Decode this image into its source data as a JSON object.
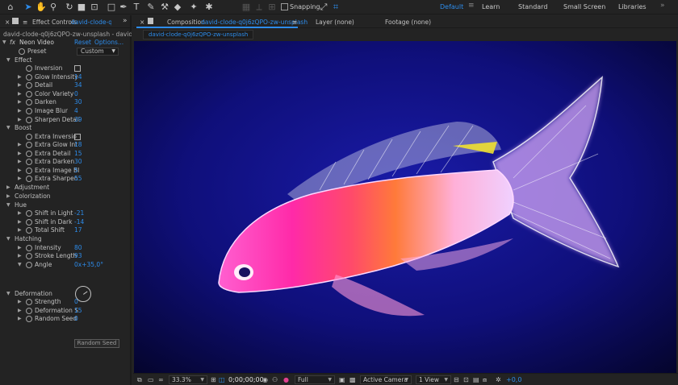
{
  "toolbar": {
    "tools": [
      "home-icon",
      "selection-icon",
      "hand-icon",
      "zoom-icon",
      "rotate-icon",
      "camera-icon",
      "pan-behind-icon",
      "rectangle-icon",
      "pen-icon",
      "type-icon",
      "brush-icon",
      "clone-stamp-icon",
      "eraser-icon",
      "roto-brush-icon",
      "puppet-pin-icon"
    ],
    "snapping_label": "Snapping",
    "workspaces": [
      "Default",
      "Learn",
      "Standard",
      "Small Screen",
      "Libraries"
    ],
    "active_workspace": "Default",
    "more": "»"
  },
  "effect_panel": {
    "tab_label": "Effect Controls",
    "tab_layer": "david-clode-q0j6",
    "subtitle": "david-clode-q0j6zQPO-zw-unsplash - david-clode-q",
    "effect_name": "Neon Video",
    "reset": "Reset",
    "options": "Options...",
    "preset_label": "Preset",
    "preset_value": "Custom",
    "rows": [
      {
        "indent": 2,
        "type": "group",
        "label": "Effect",
        "open": true
      },
      {
        "indent": 3,
        "type": "check",
        "label": "Inversion"
      },
      {
        "indent": 3,
        "type": "prop",
        "label": "Glow Intensity",
        "value": "14"
      },
      {
        "indent": 3,
        "type": "prop",
        "label": "Detail",
        "value": "34"
      },
      {
        "indent": 3,
        "type": "prop",
        "label": "Color Variety",
        "value": "0"
      },
      {
        "indent": 3,
        "type": "prop",
        "label": "Darken",
        "value": "30"
      },
      {
        "indent": 3,
        "type": "prop",
        "label": "Image Blur",
        "value": "4"
      },
      {
        "indent": 3,
        "type": "prop",
        "label": "Sharpen Detail",
        "value": "39"
      },
      {
        "indent": 2,
        "type": "group",
        "label": "Boost",
        "open": true
      },
      {
        "indent": 3,
        "type": "check",
        "label": "Extra Inversio"
      },
      {
        "indent": 3,
        "type": "prop",
        "label": "Extra Glow Int",
        "value": "18"
      },
      {
        "indent": 3,
        "type": "prop",
        "label": "Extra Detail",
        "value": "15"
      },
      {
        "indent": 3,
        "type": "prop",
        "label": "Extra Darken",
        "value": "30"
      },
      {
        "indent": 3,
        "type": "prop",
        "label": "Extra Image Bl",
        "value": "5"
      },
      {
        "indent": 3,
        "type": "prop",
        "label": "Extra Sharpen",
        "value": "55"
      },
      {
        "indent": 2,
        "type": "group",
        "label": "Adjustment",
        "open": false
      },
      {
        "indent": 2,
        "type": "group",
        "label": "Colorization",
        "open": false
      },
      {
        "indent": 2,
        "type": "group",
        "label": "Hue",
        "open": true
      },
      {
        "indent": 3,
        "type": "prop",
        "label": "Shift in Light",
        "value": "-21"
      },
      {
        "indent": 3,
        "type": "prop",
        "label": "Shift in Dark",
        "value": "-14"
      },
      {
        "indent": 3,
        "type": "prop",
        "label": "Total Shift",
        "value": "17"
      },
      {
        "indent": 2,
        "type": "group",
        "label": "Hatching",
        "open": true
      },
      {
        "indent": 3,
        "type": "prop",
        "label": "Intensity",
        "value": "80"
      },
      {
        "indent": 3,
        "type": "prop",
        "label": "Stroke Length",
        "value": "93"
      },
      {
        "indent": 3,
        "type": "prop",
        "label": "Angle",
        "value": "0x+35,0°",
        "open": true
      },
      {
        "indent": 2,
        "type": "group",
        "label": "Deformation",
        "open": true
      },
      {
        "indent": 3,
        "type": "prop",
        "label": "Strength",
        "value": "0"
      },
      {
        "indent": 3,
        "type": "prop",
        "label": "Deformation S",
        "value": "15"
      },
      {
        "indent": 3,
        "type": "prop",
        "label": "Random Seed",
        "value": "0"
      }
    ],
    "random_seed_button": "Random Seed"
  },
  "composition": {
    "tab_prefix": "Composition",
    "tab_name": "david-clode-q0j6zQPO-zw-unsplash",
    "layer_tab": "Layer (none)",
    "footage_tab": "Footage (none)",
    "breadcrumb": "david-clode-q0j6zQPO-zw-unsplash",
    "footer": {
      "zoom": "33.3%",
      "timecode": "0;00;00;00",
      "resolution": "Full",
      "camera": "Active Camera",
      "views": "1 View",
      "exposure": "+0,0"
    }
  }
}
